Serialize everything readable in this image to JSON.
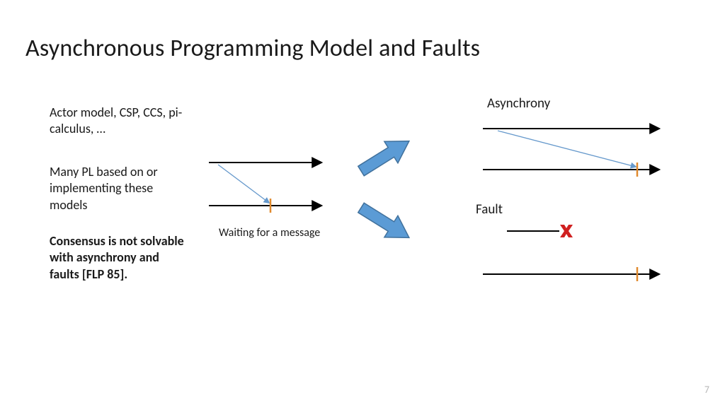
{
  "title": "Asynchronous Programming Model and Faults",
  "left": {
    "models": "Actor model, CSP, CCS, pi-calculus, …",
    "pls": "Many PL based on or implementing these models",
    "consensus": "Consensus is not solvable with asynchrony and faults [FLP 85]."
  },
  "center": {
    "waiting": "Waiting for a message"
  },
  "right": {
    "async": "Asynchrony",
    "fault": "Fault"
  },
  "page_number": "7",
  "colors": {
    "thin_arrow": "#6699cc",
    "fat_arrow_fill": "#5b9bd5",
    "fat_arrow_stroke": "#41719c",
    "tick": "#e08a2e",
    "cross": "#d02020"
  }
}
